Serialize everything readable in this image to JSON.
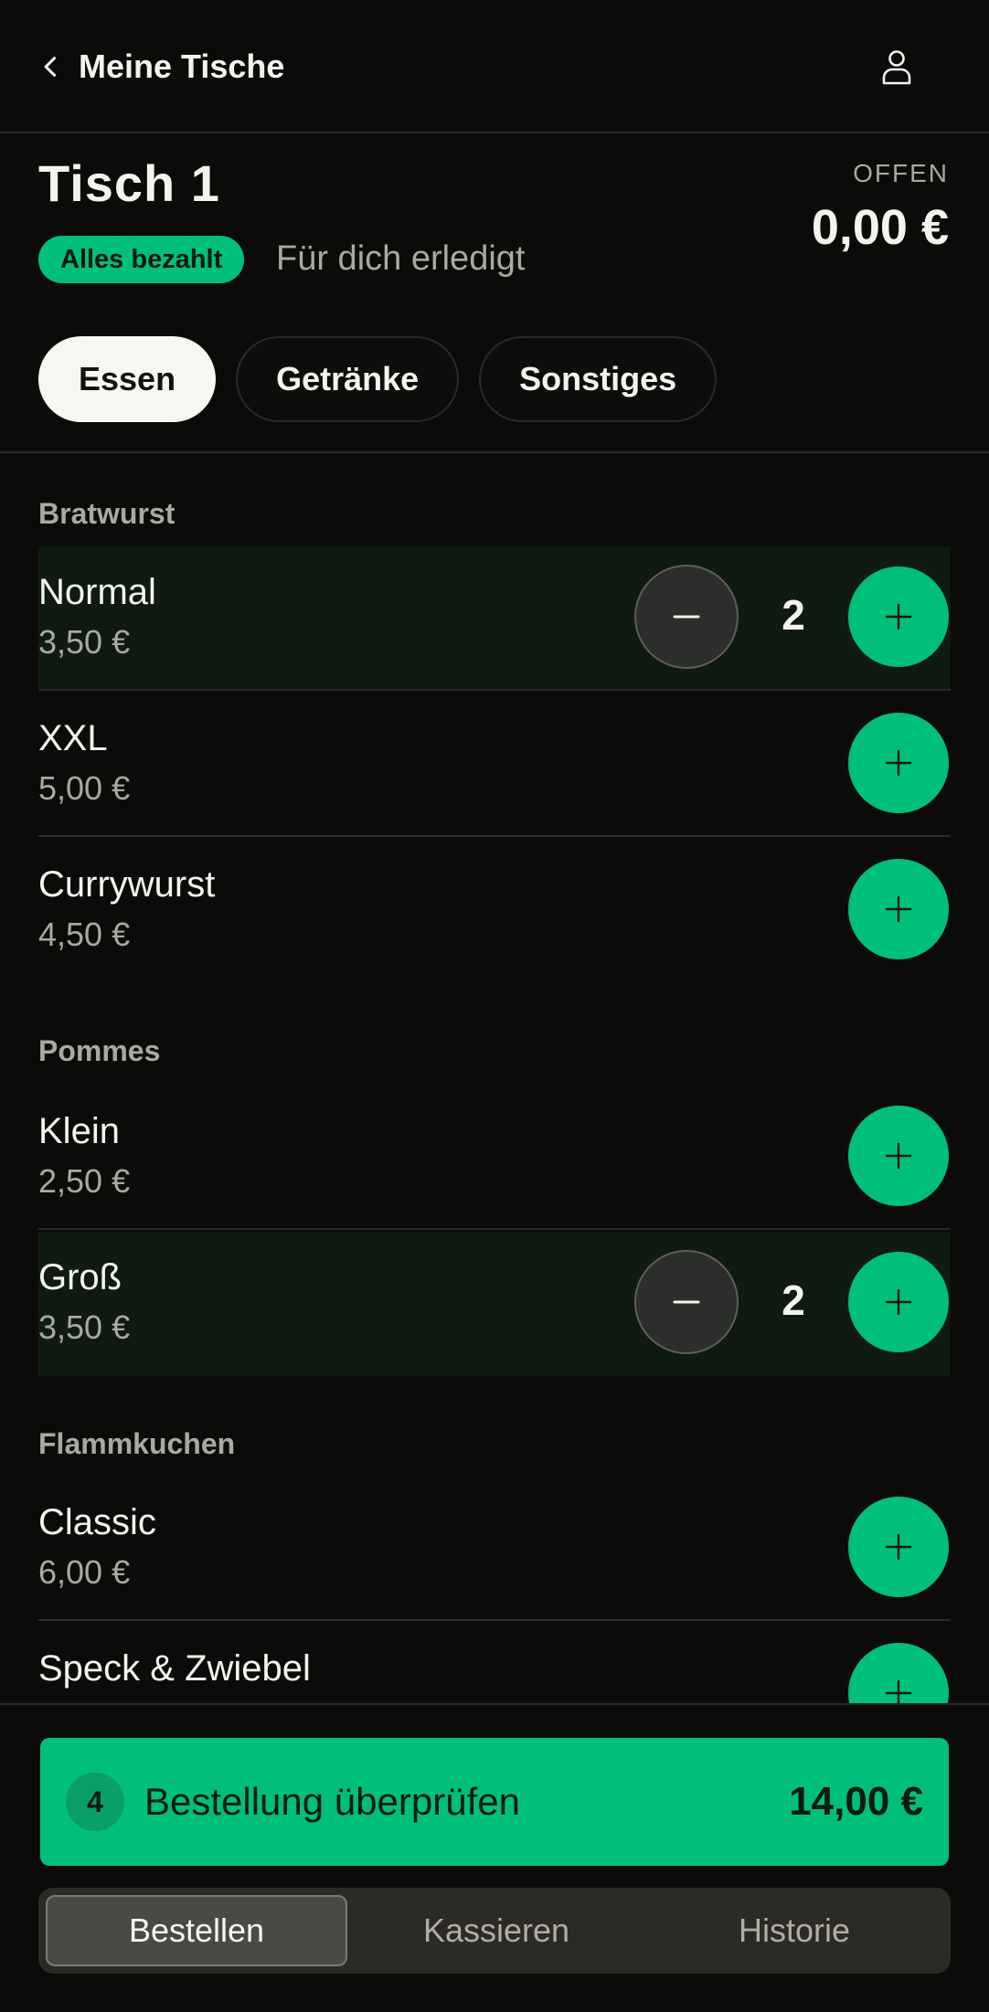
{
  "header": {
    "back_label": "Meine Tische",
    "back_icon": "chevron-left-icon",
    "profile_icon": "user-icon"
  },
  "table": {
    "title": "Tisch 1",
    "status_badge": "Alles bezahlt",
    "status_text": "Für dich erledigt",
    "open_label": "OFFEN",
    "open_amount": "0,00 €"
  },
  "categories": [
    {
      "label": "Essen",
      "active": true
    },
    {
      "label": "Getränke",
      "active": false
    },
    {
      "label": "Sonstiges",
      "active": false
    }
  ],
  "sections": [
    {
      "title": "Bratwurst",
      "items": [
        {
          "name": "Normal",
          "price": "3,50 €",
          "qty": "2"
        },
        {
          "name": "XXL",
          "price": "5,00 €"
        },
        {
          "name": "Currywurst",
          "price": "4,50 €"
        }
      ]
    },
    {
      "title": "Pommes",
      "items": [
        {
          "name": "Klein",
          "price": "2,50 €"
        },
        {
          "name": "Groß",
          "price": "3,50 €",
          "qty": "2"
        }
      ]
    },
    {
      "title": "Flammkuchen",
      "items": [
        {
          "name": "Classic",
          "price": "6,00 €"
        },
        {
          "name": "Speck & Zwiebel",
          "price": ""
        }
      ]
    }
  ],
  "review": {
    "count": "4",
    "label": "Bestellung überprüfen",
    "total": "14,00 €"
  },
  "segments": [
    {
      "label": "Bestellen",
      "active": true
    },
    {
      "label": "Kassieren",
      "active": false
    },
    {
      "label": "Historie",
      "active": false
    }
  ],
  "colors": {
    "accent": "#00bf7a",
    "background": "#0b0b0a"
  }
}
